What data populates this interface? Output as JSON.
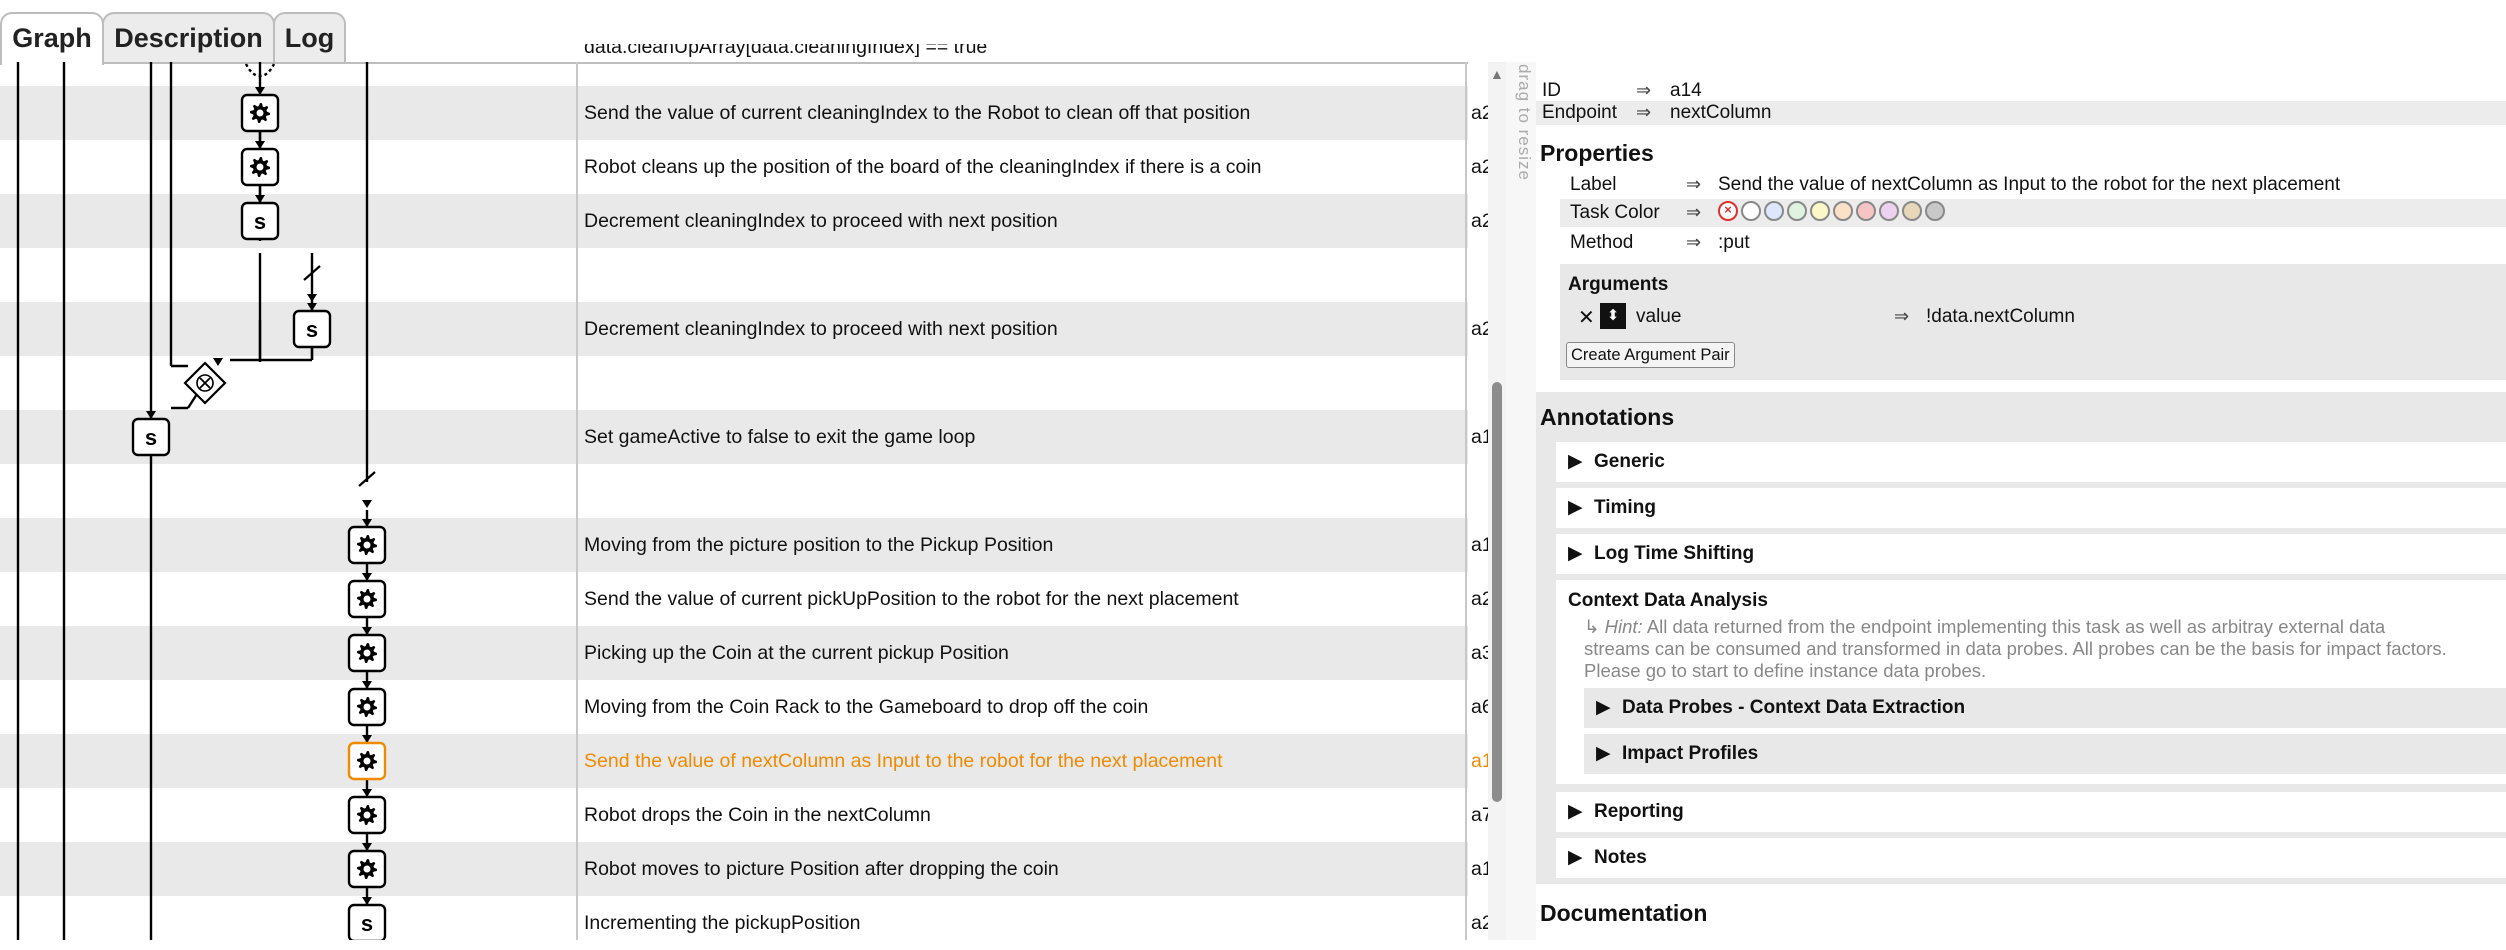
{
  "tabs": {
    "graph": "Graph",
    "description": "Description",
    "log": "Log"
  },
  "truncated_top_text": "data.cleanUpArray[data.cleaningIndex] == true",
  "rows": [
    {
      "label": "Send the value of current cleaningIndex to the Robot to clean off that position",
      "id": "a2",
      "icon": "gear"
    },
    {
      "label": "Robot cleans up the position of the board of the cleaningIndex if there is a coin",
      "id": "a2",
      "icon": "gear"
    },
    {
      "label": "Decrement cleaningIndex to proceed with next position",
      "id": "a2",
      "icon": "script"
    },
    {
      "label": "",
      "id": "",
      "icon": "none"
    },
    {
      "label": "Decrement cleaningIndex to proceed with next position",
      "id": "a2",
      "icon": "script"
    },
    {
      "label": "",
      "id": "",
      "icon": "exclusive-gateway"
    },
    {
      "label": "Set gameActive to false to exit the game loop",
      "id": "a1",
      "icon": "script"
    },
    {
      "label": "",
      "id": "",
      "icon": "none"
    },
    {
      "label": "Moving from the picture position to the Pickup Position",
      "id": "a1",
      "icon": "gear"
    },
    {
      "label": "Send the value of current pickUpPosition to the robot for the next placement",
      "id": "a2",
      "icon": "gear"
    },
    {
      "label": "Picking up the Coin at the current pickup Position",
      "id": "a3",
      "icon": "gear"
    },
    {
      "label": "Moving from the Coin Rack to the Gameboard to drop off the coin",
      "id": "a6",
      "icon": "gear"
    },
    {
      "label": "Send the value of nextColumn as Input to the robot for the next placement",
      "id": "a1",
      "icon": "gear",
      "highlighted": true
    },
    {
      "label": "Robot drops the Coin in the nextColumn",
      "id": "a7",
      "icon": "gear"
    },
    {
      "label": "Robot moves to picture Position after dropping the coin",
      "id": "a1",
      "icon": "gear"
    },
    {
      "label": "Incrementing the pickupPosition",
      "id": "a2",
      "icon": "script"
    }
  ],
  "script_glyph": "s",
  "drag_hint": "drag to resize",
  "panel": {
    "id_label": "ID",
    "id_value": "a14",
    "endpoint_label": "Endpoint",
    "endpoint_value": "nextColumn",
    "properties_heading": "Properties",
    "label_key": "Label",
    "label_value": "Send the value of nextColumn as Input to the robot for the next placement",
    "task_color_key": "Task Color",
    "task_colors": [
      "#ffffff",
      "#dde6fb",
      "#dff3e0",
      "#fbf7c9",
      "#fbe1c6",
      "#f6c4c4",
      "#ecd2ee",
      "#e8d6b8",
      "#c8c8c8"
    ],
    "method_key": "Method",
    "method_value": ":put",
    "arguments_heading": "Arguments",
    "arg_name": "value",
    "arg_value": "!data.nextColumn",
    "create_arg_button": "Create Argument Pair",
    "annotations_heading": "Annotations",
    "sections": [
      "Generic",
      "Timing",
      "Log Time Shifting"
    ],
    "context_heading": "Context Data Analysis",
    "hint_prefix": "↳",
    "hint_label": "Hint:",
    "hint_line1": "All data returned from the endpoint implementing this task as well as arbitray external data",
    "hint_line2": "streams can be consumed and transformed in data probes. All probes can be the basis for impact factors.",
    "hint_line3": "Please go to start to define instance data probes.",
    "sub_sections": [
      "Data Probes - Context Data Extraction",
      "Impact Profiles"
    ],
    "sections2": [
      "Reporting",
      "Notes"
    ],
    "documentation_heading": "Documentation"
  }
}
